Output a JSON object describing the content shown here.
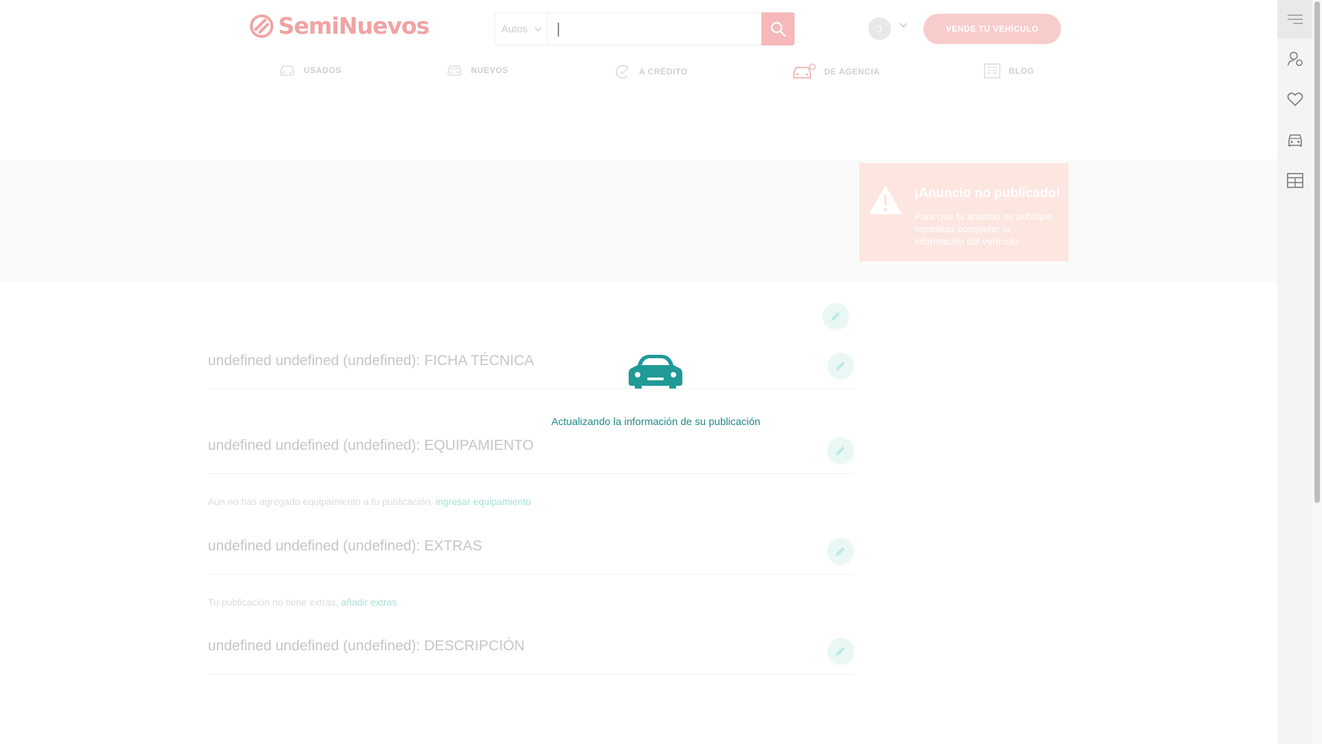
{
  "header": {
    "logo_text": "SemiNuevos",
    "search": {
      "category": "Autos",
      "placeholder": ""
    },
    "user": {
      "initial": "J"
    },
    "sell_button": "VENDE TU VEHÍCULO"
  },
  "nav": [
    {
      "label": "USADOS",
      "icon": "car-icon"
    },
    {
      "label": "NUEVOS",
      "icon": "new-car-icon"
    },
    {
      "label": "A CRÉDITO",
      "icon": "credit-icon"
    },
    {
      "label": "DE AGENCIA",
      "icon": "dealer-car-icon"
    },
    {
      "label": "BLOG",
      "icon": "blog-icon"
    }
  ],
  "alert": {
    "title": "¡Anuncio no publicado!",
    "text": "Para que tu anuncio se publique necesitas completar la información del vehículo"
  },
  "sections": [
    {
      "title": "undefined undefined (undefined): FICHA TÉCNICA"
    },
    {
      "title": "undefined undefined (undefined): EQUIPAMIENTO",
      "note": "Aún no has agregado equipamiento a tu publicación,",
      "link": "ingresar equipamiento"
    },
    {
      "title": "undefined undefined (undefined): EXTRAS",
      "note": "Tu publicación no tiene extras,",
      "link": "añadir extras"
    },
    {
      "title": "undefined undefined (undefined): DESCRIPCIÓN"
    }
  ],
  "loader": {
    "text": "Actualizando la información de su publicación",
    "icon": "car-icon"
  },
  "sidebar": [
    {
      "icon": "menu-icon"
    },
    {
      "icon": "user-settings-icon"
    },
    {
      "icon": "heart-icon"
    },
    {
      "icon": "car-icon"
    },
    {
      "icon": "grid-icon"
    }
  ],
  "colors": {
    "brand": "#e84a4a",
    "accent": "#1f8a86"
  }
}
